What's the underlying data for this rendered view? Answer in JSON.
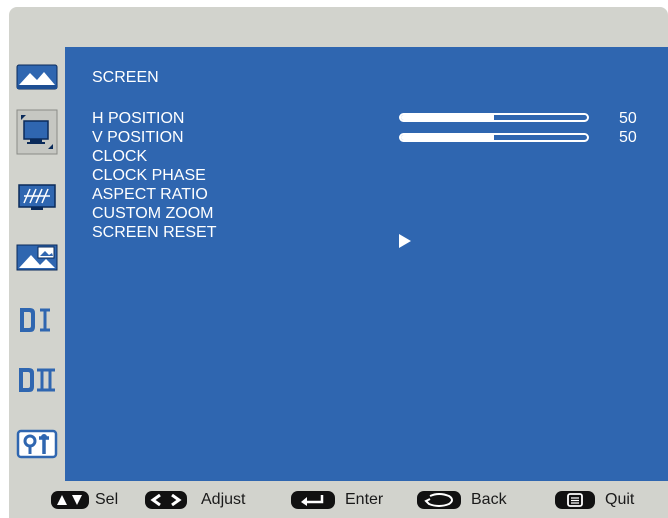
{
  "menu": {
    "title": "SCREEN",
    "items": [
      {
        "label": "H POSITION",
        "value": "50",
        "level": 0.5
      },
      {
        "label": "V POSITION",
        "value": "50",
        "level": 0.5
      },
      {
        "label": "CLOCK"
      },
      {
        "label": "CLOCK PHASE"
      },
      {
        "label": "ASPECT RATIO"
      },
      {
        "label": "CUSTOM ZOOM"
      },
      {
        "label": "SCREEN RESET",
        "action": "play-arrow-icon"
      }
    ]
  },
  "sidebar": {
    "icons": [
      "picture-icon",
      "screen-icon",
      "audio-icon",
      "pip-icon",
      "configuration-one-icon",
      "configuration-two-icon",
      "advanced-option-icon"
    ]
  },
  "footer": {
    "hints": [
      {
        "icon": "up-down-keys-icon",
        "label": "Sel"
      },
      {
        "icon": "left-right-keys-icon",
        "label": "Adjust"
      },
      {
        "icon": "enter-key-icon",
        "label": "Enter"
      },
      {
        "icon": "back-key-icon",
        "label": "Back"
      },
      {
        "icon": "menu-key-icon",
        "label": "Quit"
      }
    ]
  },
  "colors": {
    "panel": "#2f66b0",
    "frame": "#d2d3cd",
    "text": "#ffffff"
  }
}
